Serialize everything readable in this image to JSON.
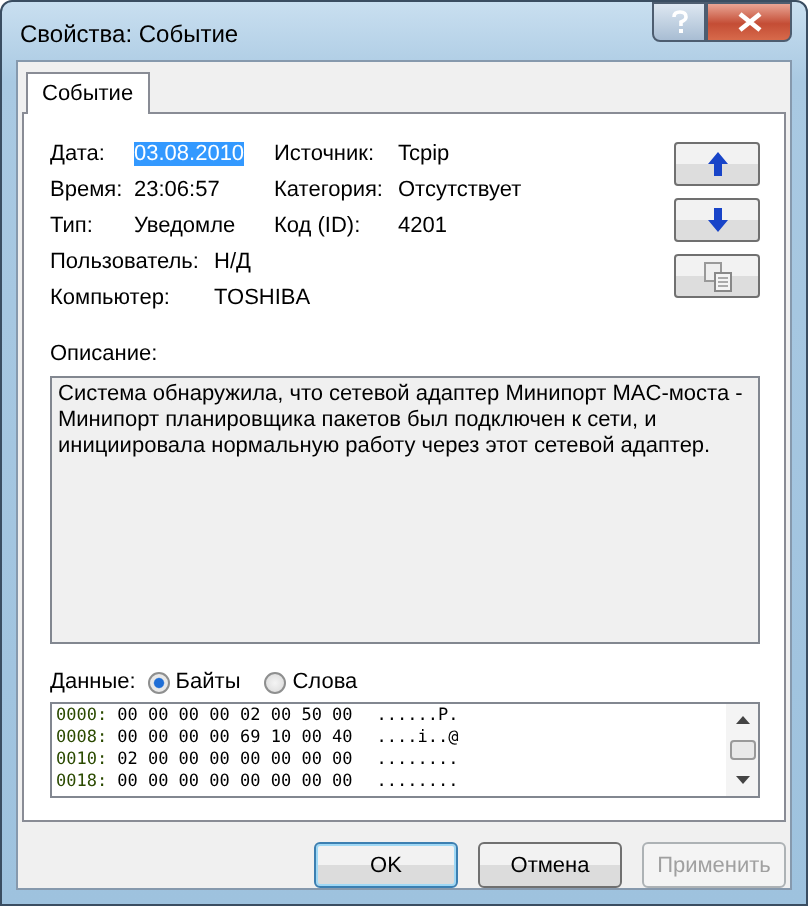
{
  "window": {
    "title": "Свойства: Событие"
  },
  "tabs": [
    {
      "label": "Событие",
      "selected": true
    }
  ],
  "fields_left": [
    {
      "label": "Дата:",
      "value": "03.08.2010",
      "highlighted": true
    },
    {
      "label": "Время:",
      "value": "23:06:57",
      "highlighted": false
    },
    {
      "label": "Тип:",
      "value": "Уведомле",
      "highlighted": false
    }
  ],
  "fields_right": [
    {
      "label": "Источник:",
      "value": "Tcpip"
    },
    {
      "label": "Категория:",
      "value": "Отсутствует"
    },
    {
      "label": "Код (ID):",
      "value": "4201"
    }
  ],
  "fields_bottom": [
    {
      "label": "Пользователь:",
      "value": "Н/Д"
    },
    {
      "label": "Компьютер:",
      "value": "TOSHIBA"
    }
  ],
  "description": {
    "label": "Описание:",
    "text": "Система обнаружила, что сетевой адаптер Минипорт MAC-моста - Минипорт планировщика пакетов был подключен к сети, и инициировала нормальную работу через этот сетевой адаптер."
  },
  "data": {
    "label": "Данные:",
    "radios": [
      {
        "label": "Байты",
        "selected": true
      },
      {
        "label": "Слова",
        "selected": false
      }
    ],
    "lines": [
      {
        "offset": "0000:",
        "bytes": "00 00 00 00 02 00 50 00",
        "ascii": "......P."
      },
      {
        "offset": "0008:",
        "bytes": "00 00 00 00 69 10 00 40",
        "ascii": "....i..@"
      },
      {
        "offset": "0010:",
        "bytes": "02 00 00 00 00 00 00 00",
        "ascii": "........"
      },
      {
        "offset": "0018:",
        "bytes": "00 00 00 00 00 00 00 00",
        "ascii": "........"
      }
    ]
  },
  "buttons": [
    {
      "label": "OK",
      "default": true,
      "disabled": false
    },
    {
      "label": "Отмена",
      "default": false,
      "disabled": false
    },
    {
      "label": "Применить",
      "default": false,
      "disabled": true
    }
  ]
}
